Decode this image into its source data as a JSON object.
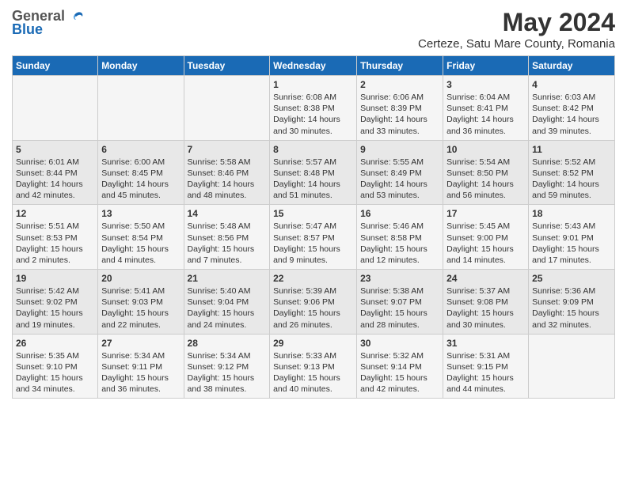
{
  "logo": {
    "general": "General",
    "blue": "Blue"
  },
  "title": "May 2024",
  "subtitle": "Certeze, Satu Mare County, Romania",
  "headers": [
    "Sunday",
    "Monday",
    "Tuesday",
    "Wednesday",
    "Thursday",
    "Friday",
    "Saturday"
  ],
  "weeks": [
    [
      {
        "day": "",
        "info": ""
      },
      {
        "day": "",
        "info": ""
      },
      {
        "day": "",
        "info": ""
      },
      {
        "day": "1",
        "info": "Sunrise: 6:08 AM\nSunset: 8:38 PM\nDaylight: 14 hours\nand 30 minutes."
      },
      {
        "day": "2",
        "info": "Sunrise: 6:06 AM\nSunset: 8:39 PM\nDaylight: 14 hours\nand 33 minutes."
      },
      {
        "day": "3",
        "info": "Sunrise: 6:04 AM\nSunset: 8:41 PM\nDaylight: 14 hours\nand 36 minutes."
      },
      {
        "day": "4",
        "info": "Sunrise: 6:03 AM\nSunset: 8:42 PM\nDaylight: 14 hours\nand 39 minutes."
      }
    ],
    [
      {
        "day": "5",
        "info": "Sunrise: 6:01 AM\nSunset: 8:44 PM\nDaylight: 14 hours\nand 42 minutes."
      },
      {
        "day": "6",
        "info": "Sunrise: 6:00 AM\nSunset: 8:45 PM\nDaylight: 14 hours\nand 45 minutes."
      },
      {
        "day": "7",
        "info": "Sunrise: 5:58 AM\nSunset: 8:46 PM\nDaylight: 14 hours\nand 48 minutes."
      },
      {
        "day": "8",
        "info": "Sunrise: 5:57 AM\nSunset: 8:48 PM\nDaylight: 14 hours\nand 51 minutes."
      },
      {
        "day": "9",
        "info": "Sunrise: 5:55 AM\nSunset: 8:49 PM\nDaylight: 14 hours\nand 53 minutes."
      },
      {
        "day": "10",
        "info": "Sunrise: 5:54 AM\nSunset: 8:50 PM\nDaylight: 14 hours\nand 56 minutes."
      },
      {
        "day": "11",
        "info": "Sunrise: 5:52 AM\nSunset: 8:52 PM\nDaylight: 14 hours\nand 59 minutes."
      }
    ],
    [
      {
        "day": "12",
        "info": "Sunrise: 5:51 AM\nSunset: 8:53 PM\nDaylight: 15 hours\nand 2 minutes."
      },
      {
        "day": "13",
        "info": "Sunrise: 5:50 AM\nSunset: 8:54 PM\nDaylight: 15 hours\nand 4 minutes."
      },
      {
        "day": "14",
        "info": "Sunrise: 5:48 AM\nSunset: 8:56 PM\nDaylight: 15 hours\nand 7 minutes."
      },
      {
        "day": "15",
        "info": "Sunrise: 5:47 AM\nSunset: 8:57 PM\nDaylight: 15 hours\nand 9 minutes."
      },
      {
        "day": "16",
        "info": "Sunrise: 5:46 AM\nSunset: 8:58 PM\nDaylight: 15 hours\nand 12 minutes."
      },
      {
        "day": "17",
        "info": "Sunrise: 5:45 AM\nSunset: 9:00 PM\nDaylight: 15 hours\nand 14 minutes."
      },
      {
        "day": "18",
        "info": "Sunrise: 5:43 AM\nSunset: 9:01 PM\nDaylight: 15 hours\nand 17 minutes."
      }
    ],
    [
      {
        "day": "19",
        "info": "Sunrise: 5:42 AM\nSunset: 9:02 PM\nDaylight: 15 hours\nand 19 minutes."
      },
      {
        "day": "20",
        "info": "Sunrise: 5:41 AM\nSunset: 9:03 PM\nDaylight: 15 hours\nand 22 minutes."
      },
      {
        "day": "21",
        "info": "Sunrise: 5:40 AM\nSunset: 9:04 PM\nDaylight: 15 hours\nand 24 minutes."
      },
      {
        "day": "22",
        "info": "Sunrise: 5:39 AM\nSunset: 9:06 PM\nDaylight: 15 hours\nand 26 minutes."
      },
      {
        "day": "23",
        "info": "Sunrise: 5:38 AM\nSunset: 9:07 PM\nDaylight: 15 hours\nand 28 minutes."
      },
      {
        "day": "24",
        "info": "Sunrise: 5:37 AM\nSunset: 9:08 PM\nDaylight: 15 hours\nand 30 minutes."
      },
      {
        "day": "25",
        "info": "Sunrise: 5:36 AM\nSunset: 9:09 PM\nDaylight: 15 hours\nand 32 minutes."
      }
    ],
    [
      {
        "day": "26",
        "info": "Sunrise: 5:35 AM\nSunset: 9:10 PM\nDaylight: 15 hours\nand 34 minutes."
      },
      {
        "day": "27",
        "info": "Sunrise: 5:34 AM\nSunset: 9:11 PM\nDaylight: 15 hours\nand 36 minutes."
      },
      {
        "day": "28",
        "info": "Sunrise: 5:34 AM\nSunset: 9:12 PM\nDaylight: 15 hours\nand 38 minutes."
      },
      {
        "day": "29",
        "info": "Sunrise: 5:33 AM\nSunset: 9:13 PM\nDaylight: 15 hours\nand 40 minutes."
      },
      {
        "day": "30",
        "info": "Sunrise: 5:32 AM\nSunset: 9:14 PM\nDaylight: 15 hours\nand 42 minutes."
      },
      {
        "day": "31",
        "info": "Sunrise: 5:31 AM\nSunset: 9:15 PM\nDaylight: 15 hours\nand 44 minutes."
      },
      {
        "day": "",
        "info": ""
      }
    ]
  ]
}
